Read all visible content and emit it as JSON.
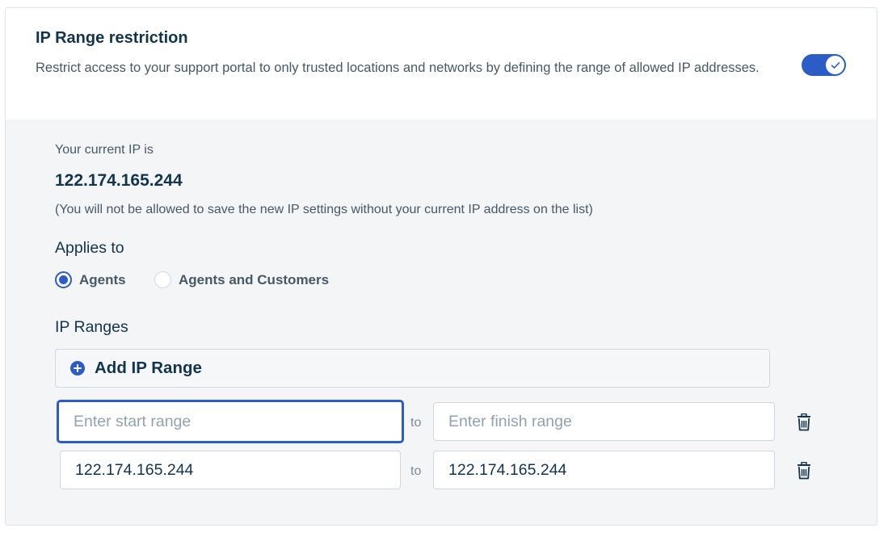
{
  "header": {
    "title": "IP Range restriction",
    "description": "Restrict access to your support portal to only trusted locations and networks by defining the range of allowed IP addresses.",
    "toggle_enabled": true
  },
  "current_ip": {
    "label": "Your current IP is",
    "value": "122.174.165.244",
    "note": "(You will not be allowed to save the new IP settings without your current IP address on the list)"
  },
  "applies_to": {
    "label": "Applies to",
    "options": [
      {
        "label": "Agents",
        "selected": true
      },
      {
        "label": "Agents and Customers",
        "selected": false
      }
    ]
  },
  "ip_ranges": {
    "label": "IP Ranges",
    "add_label": "Add IP Range",
    "separator": "to",
    "rows": [
      {
        "start_value": "",
        "start_placeholder": "Enter start range",
        "finish_value": "",
        "finish_placeholder": "Enter finish range"
      },
      {
        "start_value": "122.174.165.244",
        "start_placeholder": "Enter start range",
        "finish_value": "122.174.165.244",
        "finish_placeholder": "Enter finish range"
      }
    ]
  },
  "colors": {
    "accent": "#2c5cc5",
    "text_dark": "#12344d",
    "text_muted": "#475867",
    "body_bg": "#f3f5f7"
  },
  "icons": {
    "toggle_check": "check-icon",
    "add": "plus-circle-icon",
    "delete": "trash-icon"
  }
}
